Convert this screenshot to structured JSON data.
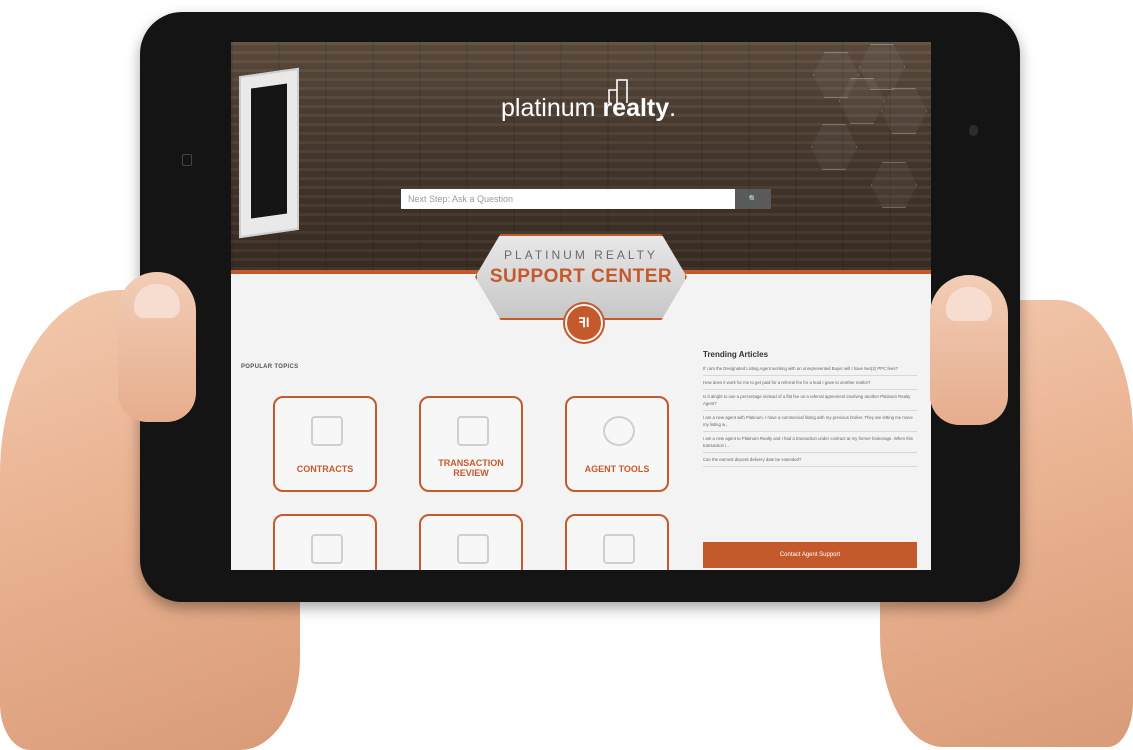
{
  "hero": {
    "logo_text_light": "platinum",
    "logo_text_bold": "realty",
    "logo_mark": ".",
    "search_placeholder": "Next Step: Ask a Question",
    "search_icon": "🔍"
  },
  "badge": {
    "top_text": "PLATINUM REALTY",
    "main_text": "SUPPORT CENTER",
    "circle_glyph": "ꟻl"
  },
  "topics": {
    "heading": "POPULAR TOPICS",
    "tiles": [
      {
        "label": "CONTRACTS",
        "icon": "contract-icon"
      },
      {
        "label": "TRANSACTION REVIEW",
        "icon": "clipboard-check-icon"
      },
      {
        "label": "AGENT TOOLS",
        "icon": "gear-wrench-icon"
      },
      {
        "label": "",
        "icon": "building-icon"
      },
      {
        "label": "",
        "icon": "house-icon"
      },
      {
        "label": "",
        "icon": "document-icon"
      }
    ]
  },
  "trending": {
    "title": "Trending Articles",
    "articles": [
      "If I am the Designated Listing Agent working with an unrepresented Buyer will I have two(2) PPC fees?",
      "How does it work for me to get paid for a referral fee for a lead I gave to another realtor?",
      "Is it alright to use a percentage instead of a flat fee on a referral agreement involving another Platinum Realty Agent?",
      "I am a new agent with Platinum. I have a commercial listing with my previous broker. They are letting me move my listing w...",
      "I am a new agent to Platinum Realty and I had a transaction under contract at my former brokerage. When this transaction i...",
      "Can the earnest deposit delivery date be extended?"
    ],
    "contact_button": "Contact Agent Support"
  },
  "colors": {
    "accent": "#c45a2c",
    "wood_dark": "#3a2d24",
    "tablet_bezel": "#141414"
  }
}
